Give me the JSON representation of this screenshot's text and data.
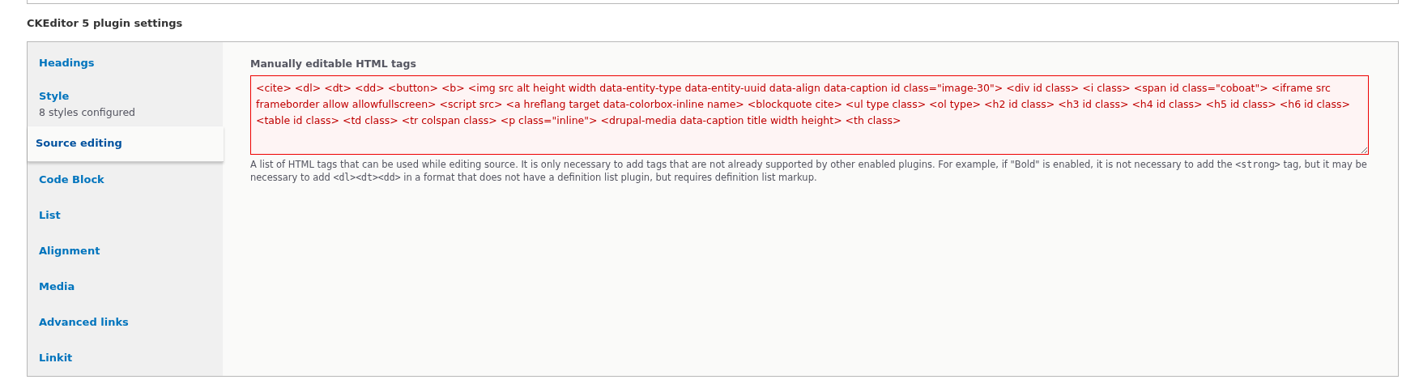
{
  "section_title": "CKEditor 5 plugin settings",
  "tabs": [
    {
      "label": "Headings",
      "selected": false
    },
    {
      "label": "Style",
      "summary": "8 styles configured",
      "selected": false
    },
    {
      "label": "Source editing",
      "selected": true
    },
    {
      "label": "Code Block",
      "selected": false
    },
    {
      "label": "List",
      "selected": false
    },
    {
      "label": "Alignment",
      "selected": false
    },
    {
      "label": "Media",
      "selected": false
    },
    {
      "label": "Advanced links",
      "selected": false
    },
    {
      "label": "Linkit",
      "selected": false
    }
  ],
  "field": {
    "label": "Manually editable HTML tags",
    "error": true,
    "value": "<cite> <dl> <dt> <dd> <button> <b> <img src alt height width data-entity-type data-entity-uuid data-align data-caption id class=\"image-30\"> <div id class> <i class> <span id class=\"coboat\"> <iframe src frameborder allow allowfullscreen> <script src> <a hreflang target data-colorbox-inline name> <blockquote cite> <ul type class> <ol type> <h2 id class> <h3 id class> <h4 id class> <h5 id class> <h6 id class> <table id class> <td class> <tr colspan class> <p class=\"inline\"> <drupal-media data-caption title width height> <th class>",
    "description": [
      {
        "kind": "text",
        "text": "A list of HTML tags that can be used while editing source. It is only necessary to add tags that are not already supported by other enabled plugins. For example, if \"Bold\" is enabled, it is not necessary to add the "
      },
      {
        "kind": "code",
        "text": "<strong>"
      },
      {
        "kind": "text",
        "text": " tag, but it may be necessary to add "
      },
      {
        "kind": "code",
        "text": "<dl><dt><dd>"
      },
      {
        "kind": "text",
        "text": " in a format that does not have a definition list plugin, but requires definition list markup."
      }
    ]
  }
}
